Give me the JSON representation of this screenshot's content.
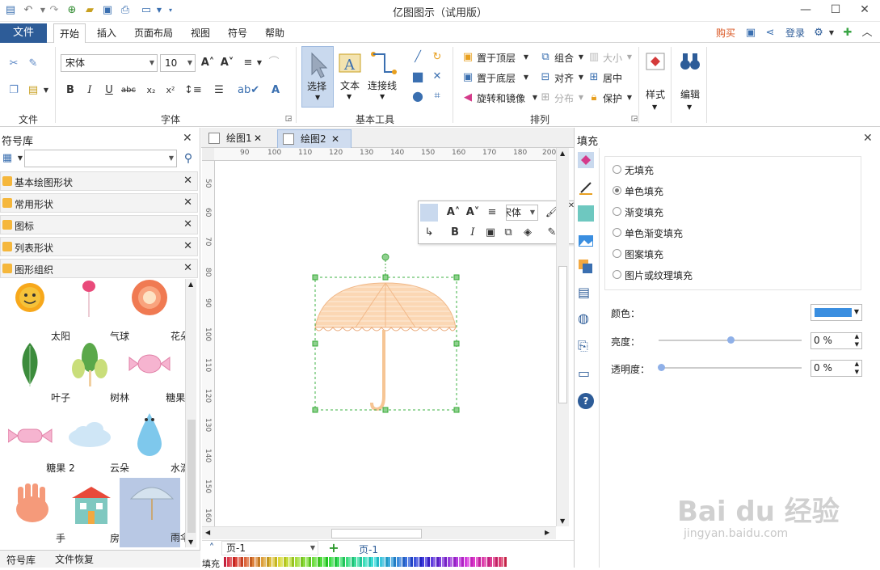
{
  "window": {
    "title": "亿图图示（试用版）"
  },
  "ribbon_tabs": {
    "file": "文件",
    "home": "开始",
    "insert": "插入",
    "layout": "页面布局",
    "view": "视图",
    "symbols": "符号",
    "help": "帮助"
  },
  "topright": {
    "buy": "购买",
    "login": "登录"
  },
  "ribbon": {
    "font_name": "宋体",
    "font_size": "10",
    "groups": {
      "file": "文件",
      "font": "字体",
      "basic_tools": "基本工具",
      "arrange": "排列"
    },
    "tools": {
      "select": "选择",
      "text": "文本",
      "connector": "连接线"
    },
    "arrange": {
      "to_top": "置于顶层",
      "group": "组合",
      "size": "大小",
      "to_bottom": "置于底层",
      "align": "对齐",
      "center": "居中",
      "rotate": "旋转和镜像",
      "distribute": "分布",
      "protect": "保护"
    },
    "style": "样式",
    "edit": "编辑"
  },
  "symbol_library": {
    "title": "符号库",
    "categories": [
      "基本绘图形状",
      "常用形状",
      "图标",
      "列表形状",
      "图形组织"
    ],
    "items": [
      "太阳",
      "气球",
      "花朵",
      "叶子",
      "树林",
      "糖果 1",
      "糖果 2",
      "云朵",
      "水滴",
      "手",
      "房子",
      "雨伞"
    ],
    "bottom_tabs": [
      "符号库",
      "文件恢复"
    ]
  },
  "doc_tabs": [
    "绘图1",
    "绘图2"
  ],
  "ruler": {
    "h": [
      "90",
      "100",
      "110",
      "120",
      "130",
      "140",
      "150",
      "160",
      "170",
      "180",
      "190",
      "200"
    ],
    "v": [
      "50",
      "60",
      "70",
      "80",
      "90",
      "100",
      "110",
      "120",
      "130",
      "140",
      "150",
      "160"
    ]
  },
  "mini_toolbar": {
    "font": "宋体"
  },
  "page_bar": {
    "page_select": "页-1",
    "page_tab": "页-1",
    "fill_label": "填充"
  },
  "fill_panel": {
    "title": "填充",
    "options": [
      "无填充",
      "单色填充",
      "渐变填充",
      "单色渐变填充",
      "图案填充",
      "图片或纹理填充"
    ],
    "selected": "单色填充",
    "color_label": "颜色：",
    "color_value": "#3a8ee0",
    "brightness_label": "亮度：",
    "brightness_value": "0 %",
    "transparency_label": "透明度：",
    "transparency_value": "0 %"
  },
  "watermark": {
    "brand": "Bai du 经验",
    "url": "jingyan.baidu.com"
  }
}
